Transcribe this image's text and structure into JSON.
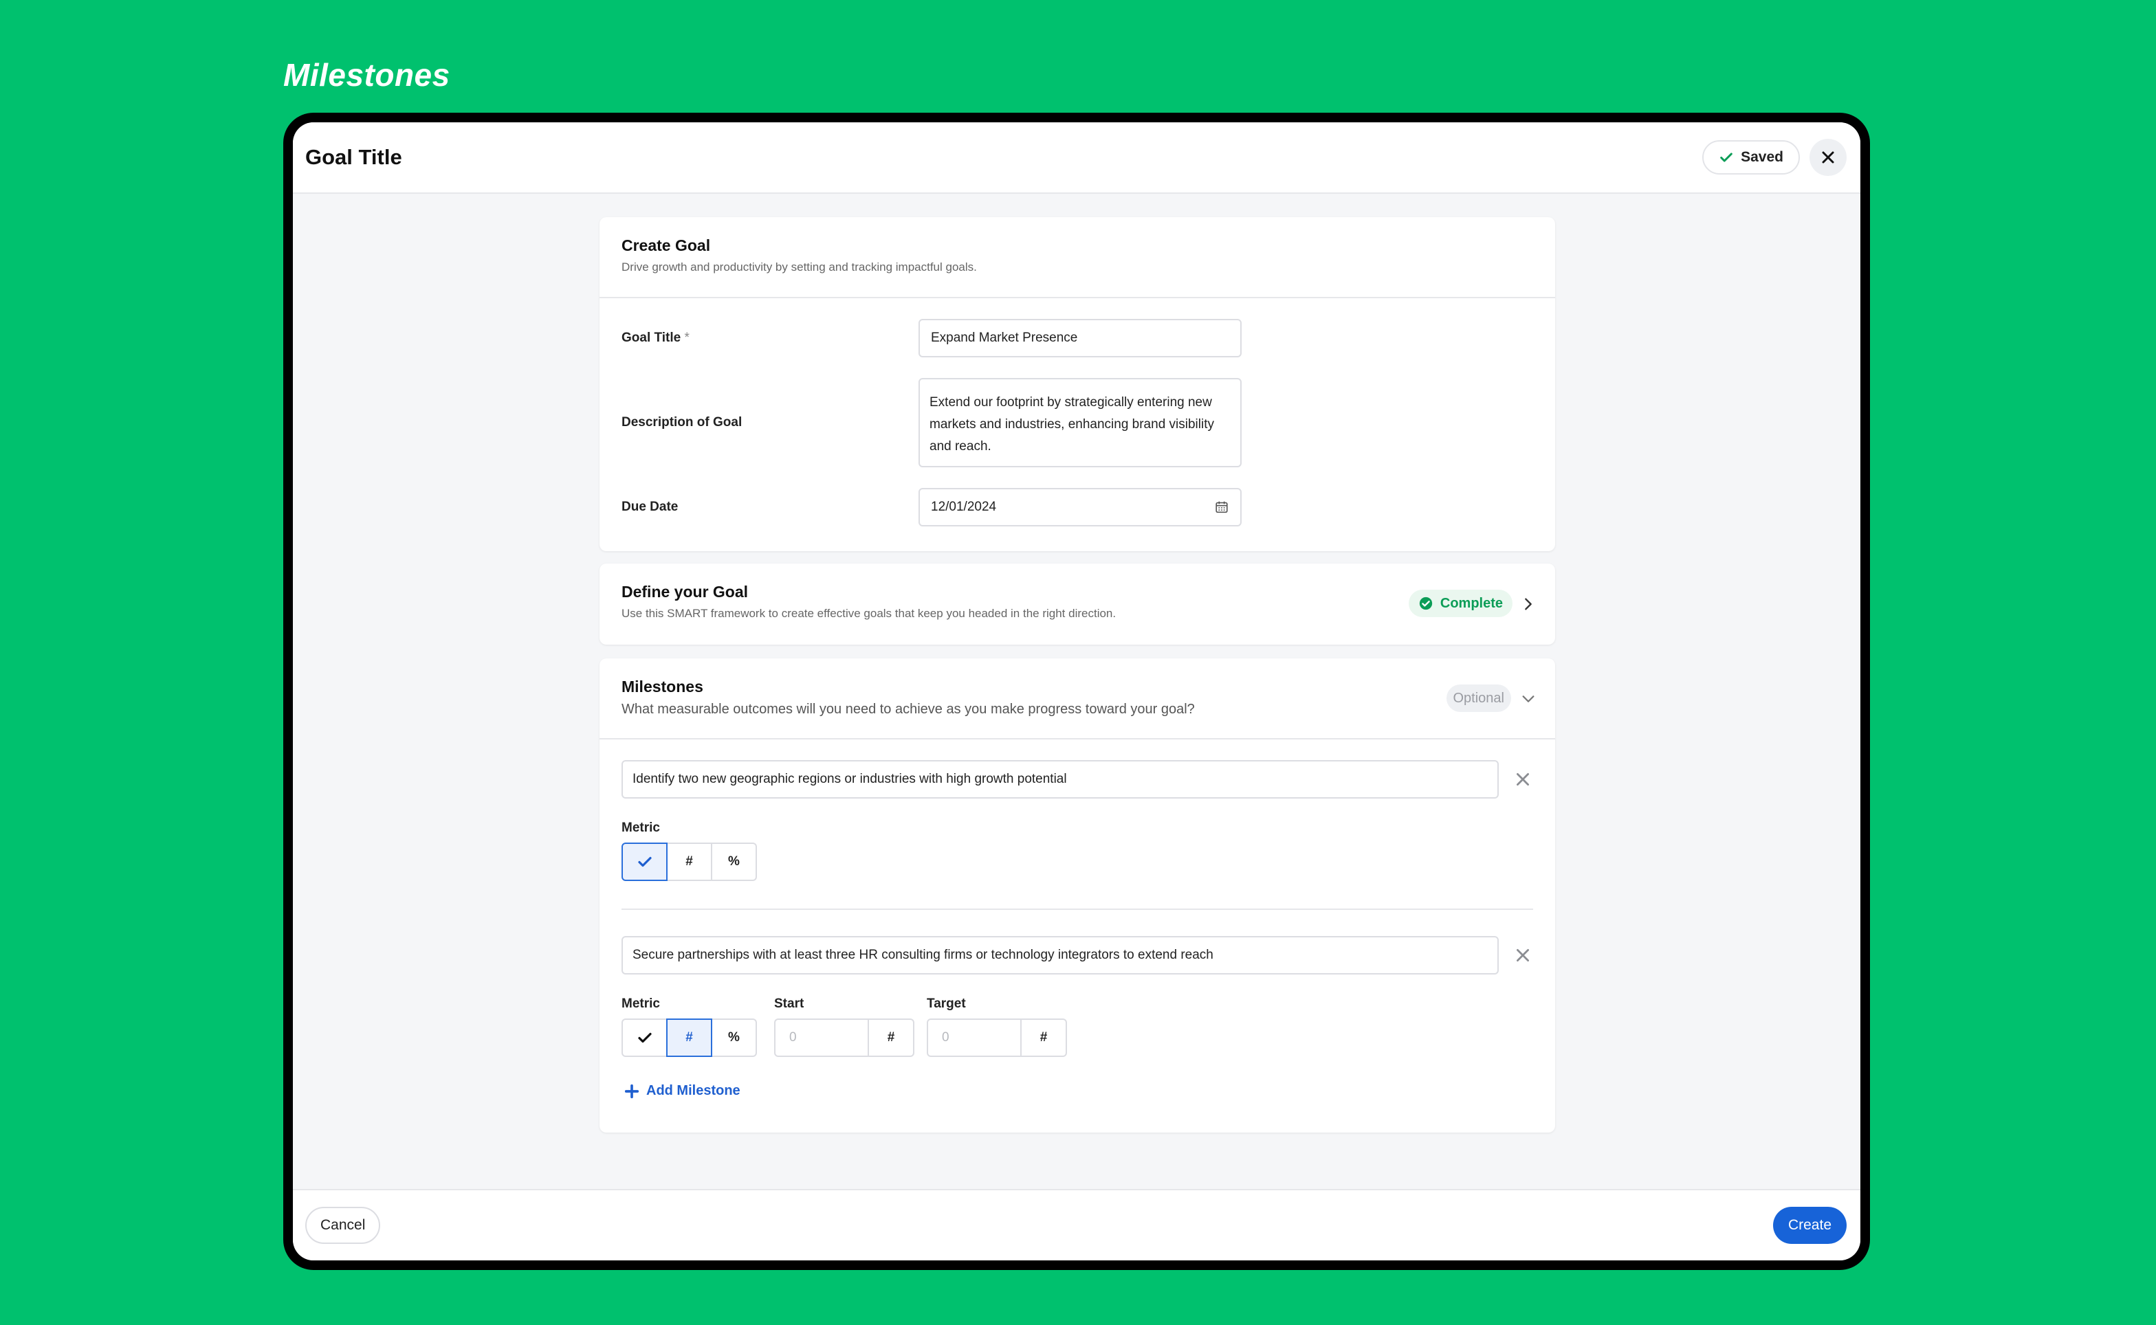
{
  "page_heading": "Milestones",
  "modal": {
    "title": "Goal Title",
    "saved_label": "Saved"
  },
  "create_goal": {
    "title": "Create Goal",
    "subtitle": "Drive growth and productivity by setting and tracking impactful goals.",
    "goal_title_label": "Goal Title",
    "required_mark": "*",
    "goal_title_value": "Expand Market Presence",
    "description_label": "Description of Goal",
    "description_value": "Extend our footprint by strategically entering new markets and industries, enhancing brand visibility and reach.",
    "due_date_label": "Due Date",
    "due_date_value": "12/01/2024"
  },
  "define_goal": {
    "title": "Define your Goal",
    "subtitle": "Use this SMART framework to create effective goals that keep you headed in the right direction.",
    "status": "Complete"
  },
  "milestones": {
    "title": "Milestones",
    "subtitle": "What measurable outcomes will you need to achieve as you make progress toward your goal?",
    "optional_label": "Optional",
    "items": [
      {
        "text": "Identify two new geographic regions or industries with high growth potential",
        "metric_label": "Metric",
        "metric_options": [
          "✔",
          "#",
          "%"
        ],
        "selected_metric": "check"
      },
      {
        "text": "Secure partnerships with at least three HR consulting firms or technology integrators to extend reach",
        "metric_label": "Metric",
        "metric_options": [
          "✔",
          "#",
          "%"
        ],
        "selected_metric": "#",
        "start_label": "Start",
        "start_placeholder": "0",
        "start_unit": "#",
        "target_label": "Target",
        "target_placeholder": "0",
        "target_unit": "#"
      }
    ],
    "add_label": "Add Milestone"
  },
  "footer": {
    "cancel_label": "Cancel",
    "create_label": "Create"
  },
  "colors": {
    "background": "#00c16e",
    "primary": "#1763d8",
    "success": "#0c9d57"
  }
}
